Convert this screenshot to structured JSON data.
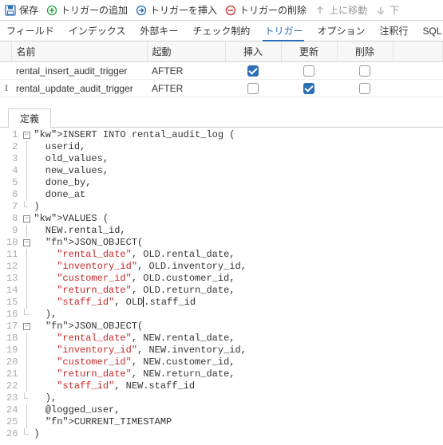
{
  "toolbar": {
    "save": "保存",
    "add_trigger": "トリガーの追加",
    "insert_trigger": "トリガーを挿入",
    "delete_trigger": "トリガーの削除",
    "move_up": "上に移動",
    "move_down": "下"
  },
  "tabs": {
    "fields": "フィールド",
    "indexes": "インデックス",
    "foreign_keys": "外部キー",
    "check_constraints": "チェック制約",
    "triggers": "トリガー",
    "options": "オプション",
    "notes": "注釈行",
    "sql_preview": "SQLプ"
  },
  "grid": {
    "headers": {
      "name": "名前",
      "fires": "起動",
      "insert": "挿入",
      "update": "更新",
      "delete": "削除"
    },
    "rows": [
      {
        "name": "rental_insert_audit_trigger",
        "fires": "AFTER",
        "insert": true,
        "update": false,
        "delete": false,
        "marker": ""
      },
      {
        "name": "rental_update_audit_trigger",
        "fires": "AFTER",
        "insert": false,
        "update": true,
        "delete": false,
        "marker": "I"
      }
    ]
  },
  "definition": {
    "tab_label": "定義",
    "lines": [
      "INSERT INTO rental_audit_log (",
      "  userid,",
      "  old_values,",
      "  new_values,",
      "  done_by,",
      "  done_at",
      ")",
      "VALUES (",
      "  NEW.rental_id,",
      "  JSON_OBJECT(",
      "    \"rental_date\", OLD.rental_date,",
      "    \"inventory_id\", OLD.inventory_id,",
      "    \"customer_id\", OLD.customer_id,",
      "    \"return_date\", OLD.return_date,",
      "    \"staff_id\", OLD.staff_id",
      "  ),",
      "  JSON_OBJECT(",
      "    \"rental_date\", NEW.rental_date,",
      "    \"inventory_id\", NEW.inventory_id,",
      "    \"customer_id\", NEW.customer_id,",
      "    \"return_date\", NEW.return_date,",
      "    \"staff_id\", NEW.staff_id",
      "  ),",
      "  @logged_user,",
      "  CURRENT_TIMESTAMP",
      ")"
    ]
  }
}
